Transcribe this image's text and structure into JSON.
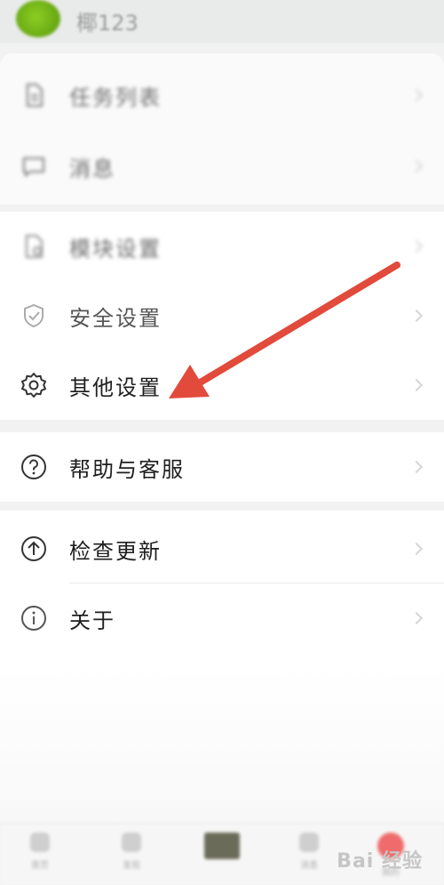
{
  "header": {
    "username": "椰123"
  },
  "menu": {
    "group1": [
      {
        "label": "任务列表",
        "icon": "document-icon"
      },
      {
        "label": "消息",
        "icon": "chat-icon"
      }
    ],
    "group2": [
      {
        "label": "模块设置",
        "icon": "file-settings-icon"
      },
      {
        "label": "安全设置",
        "icon": "shield-check-icon"
      },
      {
        "label": "其他设置",
        "icon": "gear-icon"
      }
    ],
    "group3": [
      {
        "label": "帮助与客服",
        "icon": "help-circle-icon"
      }
    ],
    "group4": [
      {
        "label": "检查更新",
        "icon": "arrow-up-circle-icon"
      },
      {
        "label": "关于",
        "icon": "info-circle-icon"
      }
    ]
  },
  "tabbar": {
    "tabs": [
      {
        "label": "首页"
      },
      {
        "label": "发现"
      },
      {
        "label": ""
      },
      {
        "label": "消息"
      },
      {
        "label": "我的"
      }
    ]
  },
  "watermark": {
    "text": "Bai 经验"
  },
  "annotation": {
    "arrow_color": "#e24a3b",
    "points_to": "其他设置"
  }
}
